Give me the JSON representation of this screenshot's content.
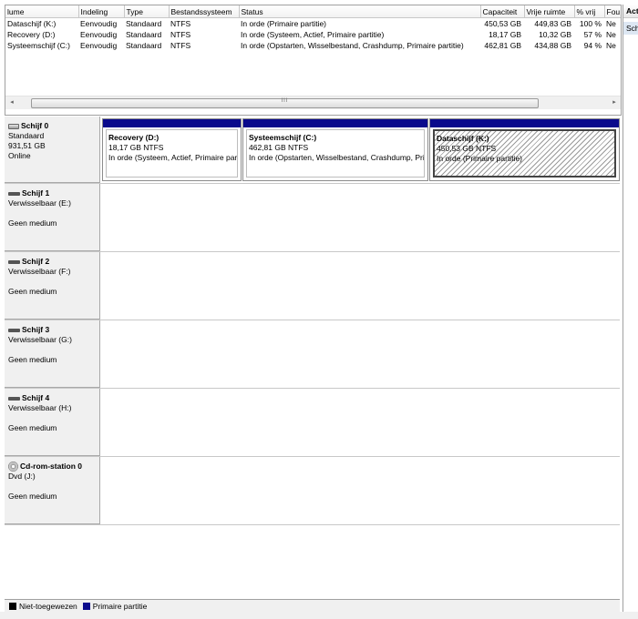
{
  "columns": [
    "lume",
    "Indeling",
    "Type",
    "Bestandssysteem",
    "Status",
    "Capaciteit",
    "Vrije ruimte",
    "% vrij",
    "Fou"
  ],
  "volumes": [
    {
      "name": "Dataschijf (K:)",
      "layout": "Eenvoudig",
      "type": "Standaard",
      "fs": "NTFS",
      "status": "In orde (Primaire partitie)",
      "capacity": "450,53 GB",
      "free": "449,83 GB",
      "pct": "100 %",
      "fault": "Ne"
    },
    {
      "name": "Recovery (D:)",
      "layout": "Eenvoudig",
      "type": "Standaard",
      "fs": "NTFS",
      "status": "In orde (Systeem, Actief, Primaire partitie)",
      "capacity": "18,17 GB",
      "free": "10,32 GB",
      "pct": "57 %",
      "fault": "Ne"
    },
    {
      "name": "Systeemschijf (C:)",
      "layout": "Eenvoudig",
      "type": "Standaard",
      "fs": "NTFS",
      "status": "In orde (Opstarten, Wisselbestand, Crashdump, Primaire partitie)",
      "capacity": "462,81 GB",
      "free": "434,88 GB",
      "pct": "94 %",
      "fault": "Ne"
    }
  ],
  "scrollbar": {
    "left": "◂",
    "right": "▸",
    "grip": "III"
  },
  "actions": {
    "header": "Act",
    "item": "Sch"
  },
  "disks": [
    {
      "name": "Schijf 0",
      "line1": "Standaard",
      "line2": "931,51 GB",
      "line3": "Online",
      "icon": "hdd-icon",
      "partitions": [
        {
          "title": "Recovery  (D:)",
          "size": "18,17 GB NTFS",
          "status": "In orde (Systeem, Actief, Primaire partitie)"
        },
        {
          "title": "Systeemschijf  (C:)",
          "size": "462,81 GB NTFS",
          "status": "In orde (Opstarten, Wisselbestand, Crashdump, Primaire partitie)"
        },
        {
          "title": "Dataschijf  (K:)",
          "size": "450,53 GB NTFS",
          "status": "In orde (Primaire partitie)"
        }
      ]
    },
    {
      "name": "Schijf 1",
      "line1": "Verwisselbaar (E:)",
      "line3": "Geen medium",
      "icon": "usb-drive-icon"
    },
    {
      "name": "Schijf 2",
      "line1": "Verwisselbaar (F:)",
      "line3": "Geen medium",
      "icon": "usb-drive-icon"
    },
    {
      "name": "Schijf 3",
      "line1": "Verwisselbaar (G:)",
      "line3": "Geen medium",
      "icon": "usb-drive-icon"
    },
    {
      "name": "Schijf 4",
      "line1": "Verwisselbaar (H:)",
      "line3": "Geen medium",
      "icon": "usb-drive-icon"
    },
    {
      "name": "Cd-rom-station 0",
      "line1": "Dvd (J:)",
      "line3": "Geen medium",
      "icon": "cdrom-icon"
    }
  ],
  "legend": [
    {
      "label": "Niet-toegewezen",
      "color": "#000000"
    },
    {
      "label": "Primaire partitie",
      "color": "#0a0a8c"
    }
  ]
}
